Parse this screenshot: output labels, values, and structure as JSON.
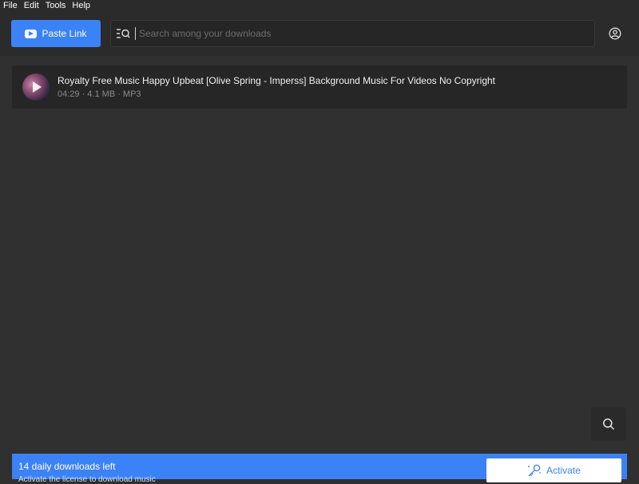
{
  "menu": {
    "items": [
      "File",
      "Edit",
      "Tools",
      "Help"
    ]
  },
  "toolbar": {
    "paste_label": "Paste Link",
    "paste_icon": "youtube-icon",
    "search_icon": "filter-search-icon",
    "account_icon": "account-icon"
  },
  "search": {
    "placeholder": "Search among your downloads",
    "value": ""
  },
  "downloads": [
    {
      "title": "Royalty Free Music Happy Upbeat [Olive Spring - Imperss] Background Music For Videos No Copyright",
      "meta": "04:29 · 4.1 MB · MP3"
    }
  ],
  "floating": {
    "search_icon": "search-icon"
  },
  "footer": {
    "title": "14 daily downloads left",
    "subtitle": "Activate the license to download music",
    "activate_label": "Activate",
    "activate_icon": "key-icon"
  },
  "colors": {
    "accent": "#3b82f6",
    "background": "#303030",
    "toolbar": "#2b2b2b",
    "item_background": "#262626"
  }
}
